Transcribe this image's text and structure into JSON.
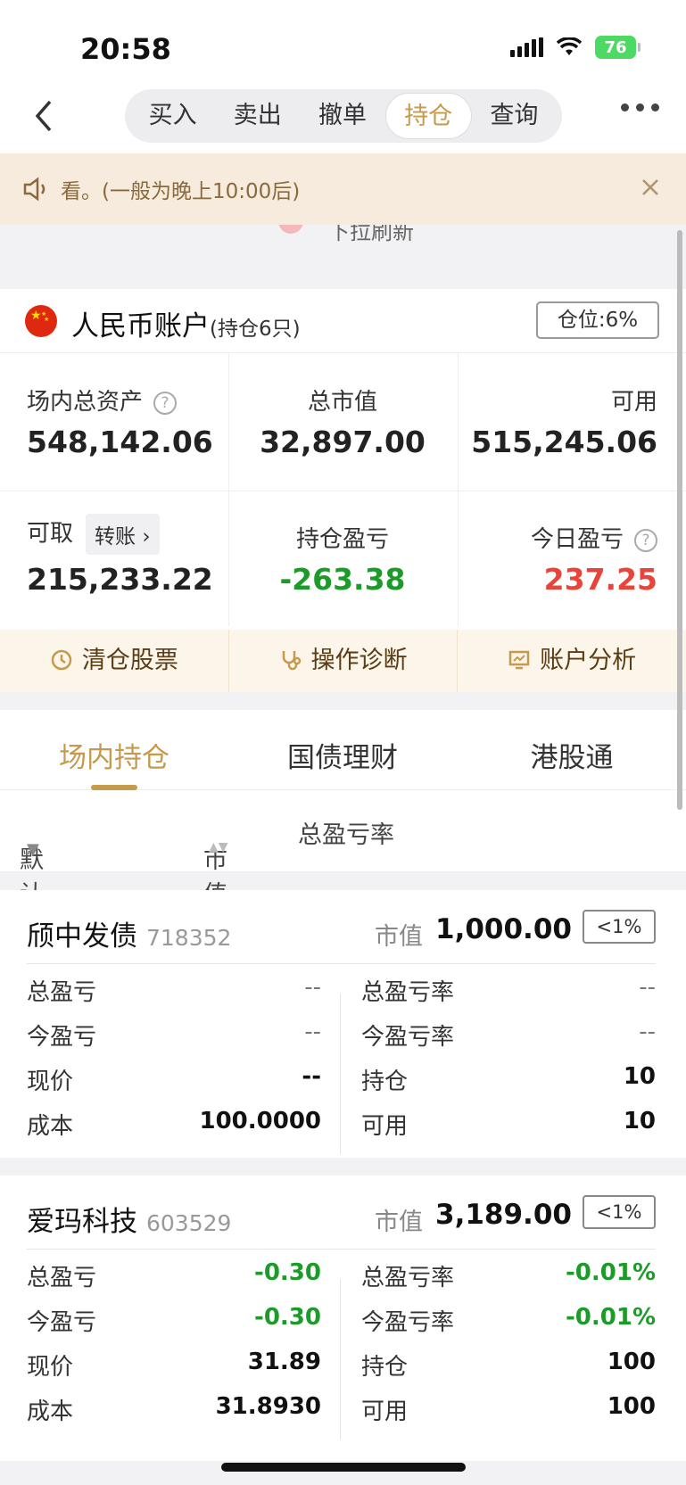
{
  "status": {
    "time": "20:58",
    "battery": "76"
  },
  "nav": {
    "tabs": [
      "买入",
      "卖出",
      "撤单",
      "持仓",
      "查询"
    ],
    "active": 3
  },
  "notice": {
    "text": "看。(一般为晚上10:00后)"
  },
  "refresh": {
    "text": "下拉刷新"
  },
  "account": {
    "title": "人民币账户",
    "holding_count": "(持仓6只)",
    "position": "仓位:6%"
  },
  "stats": {
    "total_assets_label": "场内总资产",
    "total_assets": "548,142.06",
    "market_value_label": "总市值",
    "market_value": "32,897.00",
    "available_label": "可用",
    "available": "515,245.06",
    "withdrawable_label": "可取",
    "transfer_label": "转账",
    "withdrawable": "215,233.22",
    "holding_pl_label": "持仓盈亏",
    "holding_pl": "-263.38",
    "today_pl_label": "今日盈亏",
    "today_pl": "237.25"
  },
  "actions": [
    "清仓股票",
    "操作诊断",
    "账户分析"
  ],
  "tabs": [
    "场内持仓",
    "国债理财",
    "港股通"
  ],
  "sort": {
    "default": "默认排序",
    "market_value": "市值",
    "total_pl_rate": "总盈亏率"
  },
  "labels": {
    "market_value": "市值",
    "total_pl": "总盈亏",
    "today_pl": "今盈亏",
    "price": "现价",
    "cost": "成本",
    "total_pl_rate": "总盈亏率",
    "today_pl_rate": "今盈亏率",
    "holding": "持仓",
    "available": "可用"
  },
  "holdings": [
    {
      "name": "颀中发债",
      "code": "718352",
      "market_value": "1,000.00",
      "pct": "<1%",
      "total_pl": "--",
      "today_pl": "--",
      "price": "--",
      "cost": "100.0000",
      "total_pl_rate": "--",
      "today_pl_rate": "--",
      "holding": "10",
      "available": "10"
    },
    {
      "name": "爱玛科技",
      "code": "603529",
      "market_value": "3,189.00",
      "pct": "<1%",
      "total_pl": "-0.30",
      "today_pl": "-0.30",
      "price": "31.89",
      "cost": "31.8930",
      "total_pl_rate": "-0.01%",
      "today_pl_rate": "-0.01%",
      "holding": "100",
      "available": "100"
    }
  ],
  "colors": {
    "accent": "#c59a4c",
    "gain": "#e9443a",
    "loss": "#1d9b2a"
  }
}
